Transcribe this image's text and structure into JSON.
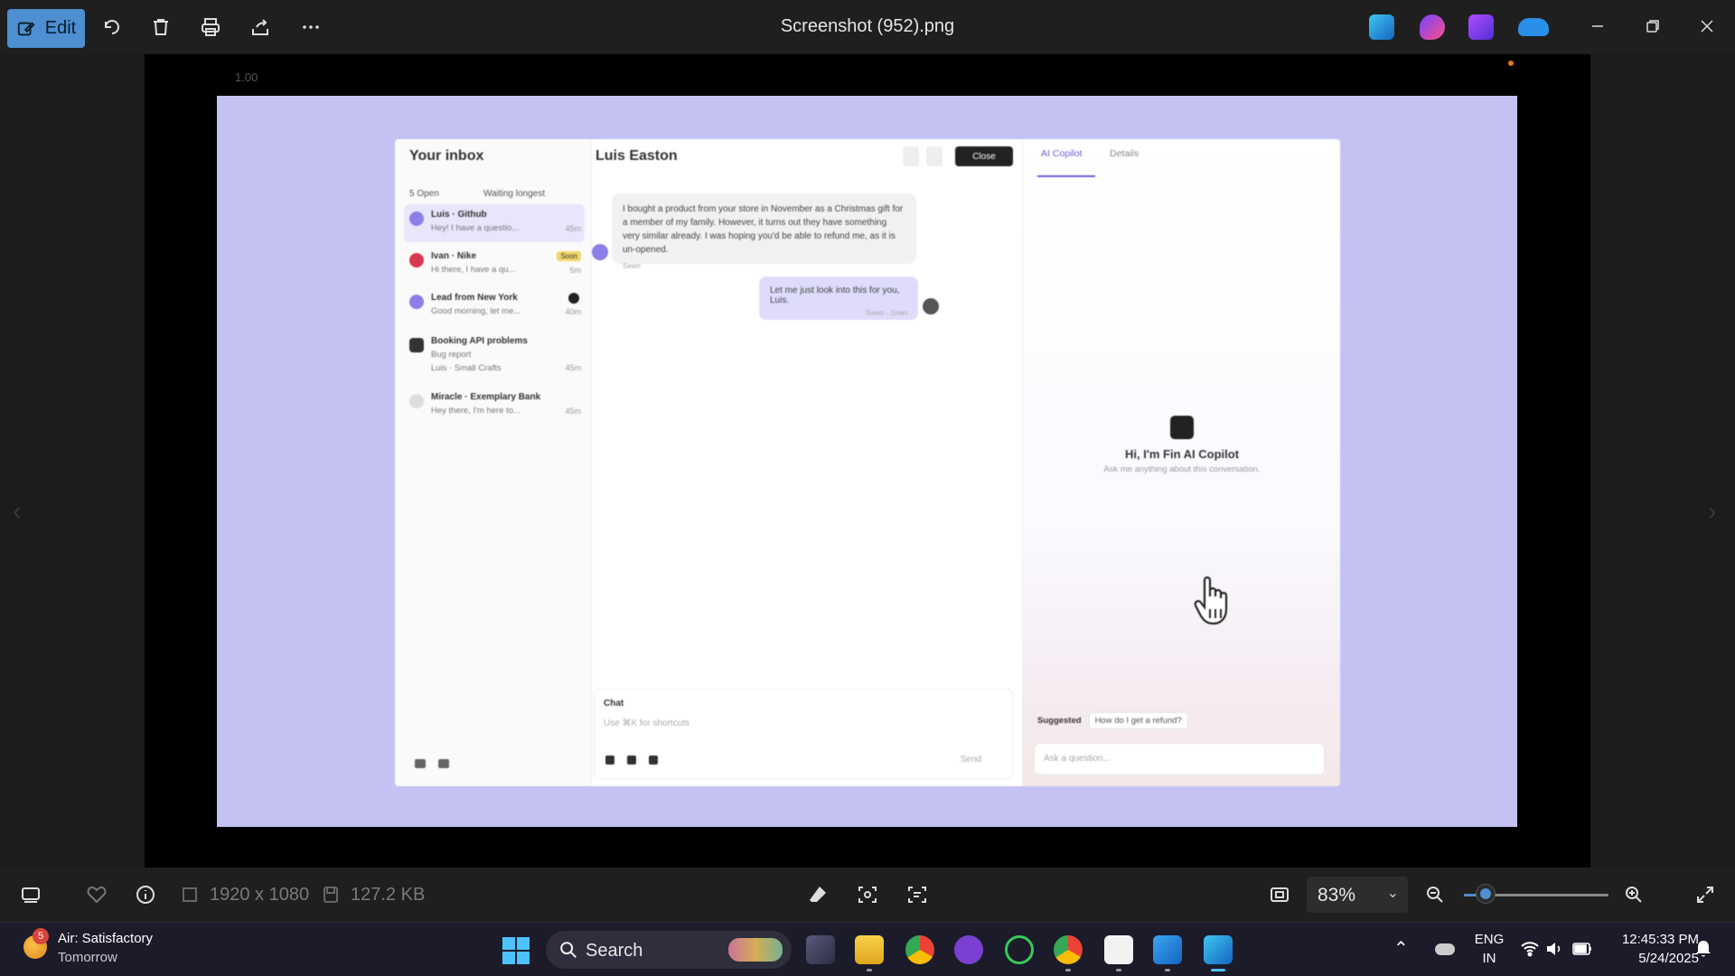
{
  "window": {
    "title": "Screenshot (952).png",
    "edit_label": "Edit"
  },
  "viewer": {
    "timer_text": "1.00",
    "screenshot": {
      "inbox": {
        "title": "Your inbox",
        "filter_left": "5 Open",
        "filter_right": "Waiting longest",
        "conversations": [
          {
            "name": "Luis · Github",
            "preview": "Hey! I have a questio...",
            "time": "45m"
          },
          {
            "name": "Ivan · Nike",
            "preview": "Hi there, I have a qu...",
            "time": "5m",
            "badge": "Soon"
          },
          {
            "name": "Lead from New York",
            "preview": "Good morning, let me...",
            "time": "40m"
          },
          {
            "name": "Booking API problems",
            "preview": "Bug report",
            "extra": "Luis · Small Crafts",
            "time": "45m"
          },
          {
            "name": "Miracle · Exemplary Bank",
            "preview": "Hey there, I'm here to...",
            "time": "45m"
          }
        ]
      },
      "chat": {
        "contact": "Luis Easton",
        "close_label": "Close",
        "incoming": "I bought a product from your store in November as a Christmas gift for a member of my family. However, it turns out they have something very similar already. I was hoping you'd be able to refund me, as it is un-opened.",
        "incoming_meta": "Seen",
        "outgoing": "Let me just look into this for you, Luis.",
        "outgoing_meta": "Seen · 1min",
        "composer_mode": "Chat",
        "composer_hint": "Use ⌘K for shortcuts",
        "send_label": "Send"
      },
      "copilot": {
        "tab_active": "AI Copilot",
        "tab_other": "Details",
        "greeting": "Hi, I'm Fin AI Copilot",
        "subtext": "Ask me anything about this conversation.",
        "suggested_label": "Suggested",
        "suggested_chip": "How do I get a refund?",
        "input_placeholder": "Ask a question..."
      }
    }
  },
  "infobar": {
    "dimensions": "1920 x 1080",
    "file_size": "127.2 KB",
    "zoom": "83%",
    "zoom_fraction": 0.15
  },
  "taskbar": {
    "weather_main": "Air: Satisfactory",
    "weather_sub": "Tomorrow",
    "weather_badge": "5",
    "search_label": "Search",
    "lang_top": "ENG",
    "lang_bottom": "IN",
    "time": "12:45:33 PM",
    "date": "5/24/2025"
  },
  "colors": {
    "accent": "#4d8fd0",
    "canvas": "#c4c2f3",
    "taskbar": "#1b1b2a"
  }
}
